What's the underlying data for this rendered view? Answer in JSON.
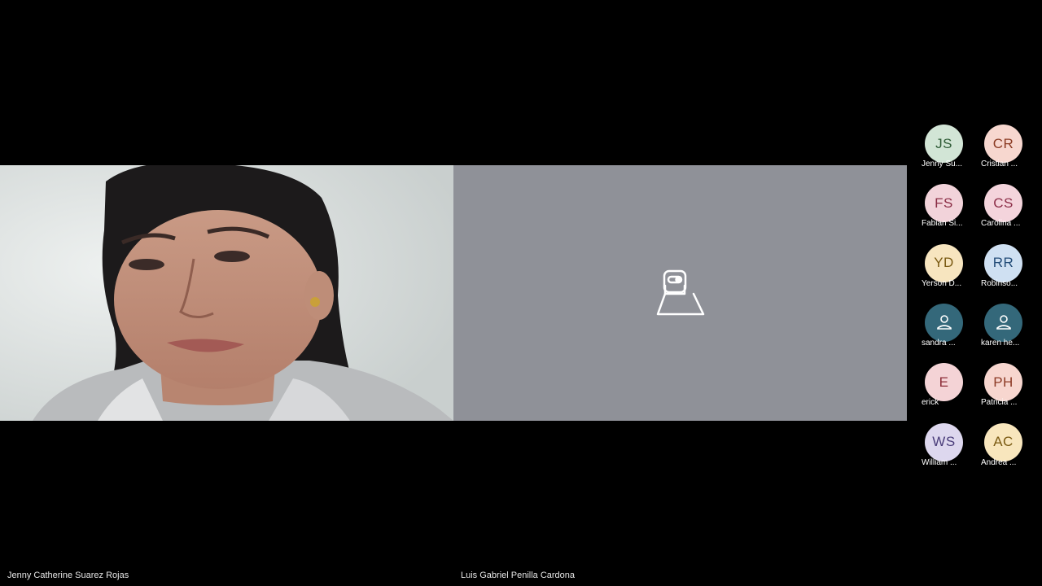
{
  "tiles": {
    "left": {
      "participant_name": "Jenny Catherine Suarez Rojas",
      "video_state": "camera-on"
    },
    "right": {
      "participant_name": "Luis Gabriel Penilla Cardona",
      "video_state": "camera-off",
      "icon": "camera-off-icon"
    }
  },
  "roster": [
    {
      "initials": "JS",
      "name": "Jenny Su...",
      "bg": "#d2e5d6",
      "fg": "#2d5a35"
    },
    {
      "initials": "CR",
      "name": "Cristian ...",
      "bg": "#f7d7cf",
      "fg": "#8a3a22"
    },
    {
      "initials": "FS",
      "name": "Fabian Si...",
      "bg": "#f2d3da",
      "fg": "#8a2d45"
    },
    {
      "initials": "CS",
      "name": "Carolina ...",
      "bg": "#f4d4dc",
      "fg": "#8c2e48"
    },
    {
      "initials": "YD",
      "name": "Yerson D...",
      "bg": "#f7e5bf",
      "fg": "#7a5a12"
    },
    {
      "initials": "RR",
      "name": "Robinso...",
      "bg": "#cfe0f2",
      "fg": "#234c78"
    },
    {
      "initials": "",
      "name": "sandra ...",
      "bg": "#34687a",
      "fg": "#ffffff",
      "icon": "person-icon"
    },
    {
      "initials": "",
      "name": "karen he...",
      "bg": "#34687a",
      "fg": "#ffffff",
      "icon": "person-icon"
    },
    {
      "initials": "E",
      "name": "erick",
      "bg": "#f4d3d6",
      "fg": "#8c2d38"
    },
    {
      "initials": "PH",
      "name": "Patricia ...",
      "bg": "#f7d6cf",
      "fg": "#8c3a25"
    },
    {
      "initials": "WS",
      "name": "William ...",
      "bg": "#ddd7ee",
      "fg": "#4a3d7a"
    },
    {
      "initials": "AC",
      "name": "Andrea ...",
      "bg": "#f8e6bd",
      "fg": "#7a5a12"
    }
  ]
}
